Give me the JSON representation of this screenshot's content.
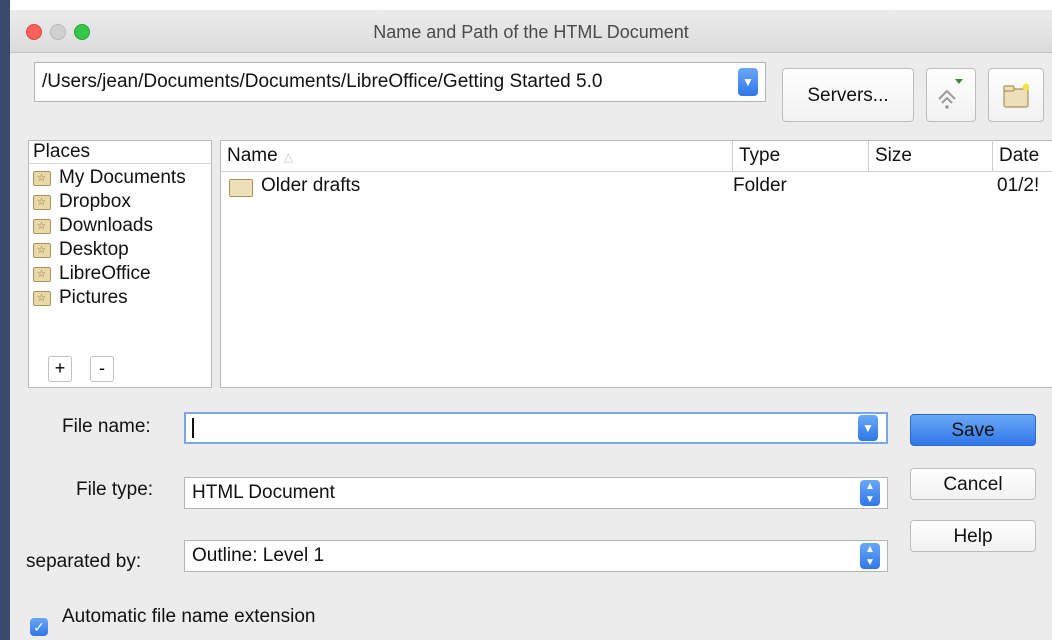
{
  "window": {
    "title": "Name and Path of the HTML Document"
  },
  "path": {
    "value": "/Users/jean/Documents/Documents/LibreOffice/Getting Started 5.0"
  },
  "toolbar": {
    "servers_label": "Servers..."
  },
  "places": {
    "header": "Places",
    "items": [
      "My Documents",
      "Dropbox",
      "Downloads",
      "Desktop",
      "LibreOffice",
      "Pictures"
    ],
    "add_label": "+",
    "remove_label": "-"
  },
  "files": {
    "columns": [
      "Name",
      "Type",
      "Size",
      "Date"
    ],
    "rows": [
      {
        "name": "Older drafts",
        "type": "Folder",
        "size": "",
        "date": "01/2!"
      }
    ]
  },
  "form": {
    "file_name_label": "File name:",
    "file_name_value": "",
    "file_type_label": "File type:",
    "file_type_value": "HTML Document",
    "separated_by_label": "separated by:",
    "separated_by_value": "Outline: Level 1",
    "auto_ext_label": "Automatic file name extension",
    "auto_ext_checked": true
  },
  "buttons": {
    "save": "Save",
    "cancel": "Cancel",
    "help": "Help"
  },
  "colors": {
    "accent": "#2f77e9",
    "close": "#fc605c",
    "maximize": "#34c84a"
  },
  "icons": [
    "chevron-down-icon",
    "up-one-level-icon",
    "new-folder-icon",
    "folder-icon",
    "checkmark-icon"
  ]
}
